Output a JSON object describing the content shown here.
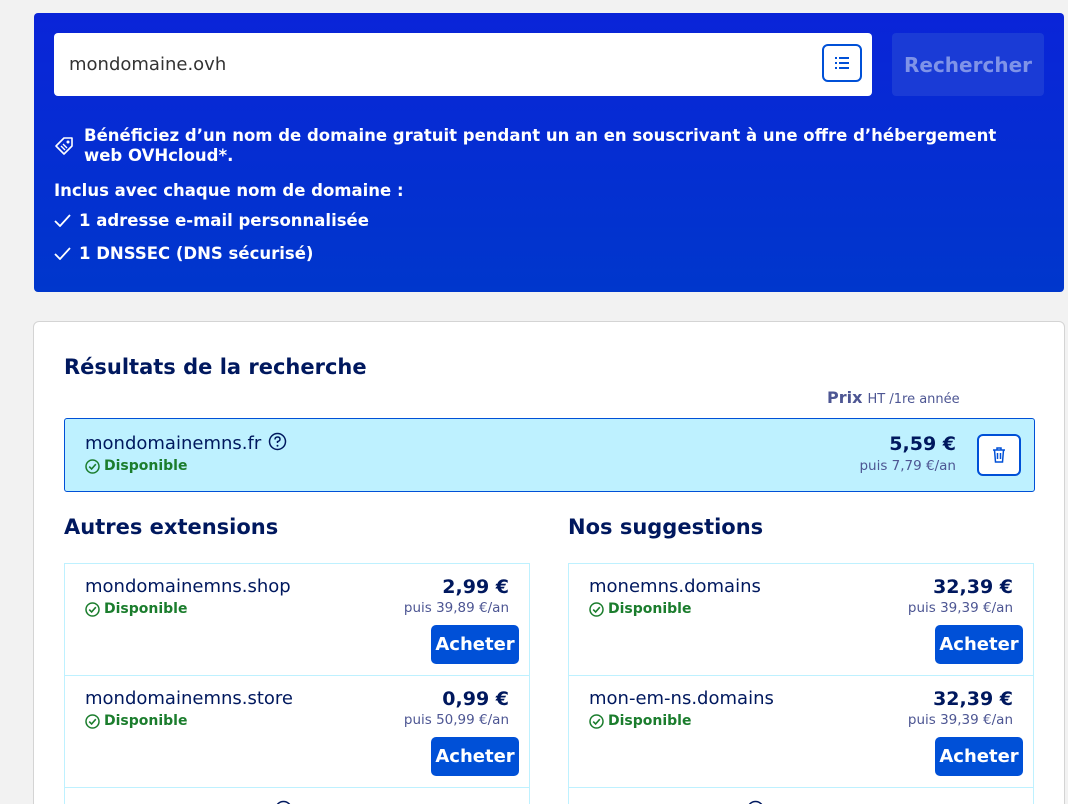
{
  "search": {
    "value": "mondomaine.ovh",
    "button_label": "Rechercher"
  },
  "promo": {
    "text": "Bénéficiez d’un nom de domaine gratuit pendant un an en souscrivant à une offre d’hébergement web OVHcloud*.",
    "included_title": "Inclus avec chaque nom de domaine :",
    "features": [
      "1 adresse e-mail personnalisée",
      "1 DNSSEC (DNS sécurisé)"
    ]
  },
  "results": {
    "title": "Résultats de la recherche",
    "price_label": "Prix",
    "price_suffix": "HT /1re année",
    "main": {
      "domain": "mondomainemns.fr",
      "status": "Disponible",
      "price": "5,59 €",
      "renewal": "puis 7,79 €/an"
    }
  },
  "other_extensions": {
    "title": "Autres extensions",
    "items": [
      {
        "domain": "mondomainemns.shop",
        "status": "Disponible",
        "price": "2,99 €",
        "renewal": "puis 39,89 €/an",
        "button": "Acheter"
      },
      {
        "domain": "mondomainemns.store",
        "status": "Disponible",
        "price": "0,99 €",
        "renewal": "puis 50,99 €/an",
        "button": "Acheter"
      }
    ]
  },
  "suggestions": {
    "title": "Nos suggestions",
    "items": [
      {
        "domain": "monemns.domains",
        "status": "Disponible",
        "price": "32,39 €",
        "renewal": "puis 39,39 €/an",
        "button": "Acheter"
      },
      {
        "domain": "mon-em-ns.domains",
        "status": "Disponible",
        "price": "32,39 €",
        "renewal": "puis 39,39 €/an",
        "button": "Acheter"
      }
    ]
  },
  "colors": {
    "hero": "#0a24d8",
    "primary": "#0050d7",
    "available": "#1b7d2d",
    "highlight": "#bef1ff",
    "heading": "#00185e"
  },
  "icons": [
    "list-icon",
    "tag-icon",
    "check-icon",
    "help-icon",
    "check-circle-icon",
    "trash-icon"
  ]
}
